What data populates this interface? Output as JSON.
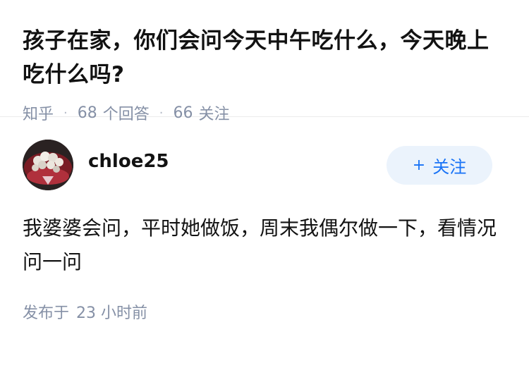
{
  "question": {
    "title": "孩子在家，你们会问今天中午吃什么，今天晚上吃什么吗?",
    "site": "知乎",
    "separator": "·",
    "answers_count": "68",
    "answers_label": "个回答",
    "followers_count": "66",
    "followers_label": "关注"
  },
  "answer": {
    "author": "chloe25",
    "follow_plus": "+",
    "follow_label": "关注",
    "content": "我婆婆会问，平时她做饭，周末我偶尔做一下，看情况问一问",
    "published_label": "发布于",
    "published_time": "23 小时前"
  },
  "colors": {
    "meta_gray": "#8590a6",
    "accent_blue": "#1772f6",
    "follow_bg": "#ebf3fc"
  }
}
